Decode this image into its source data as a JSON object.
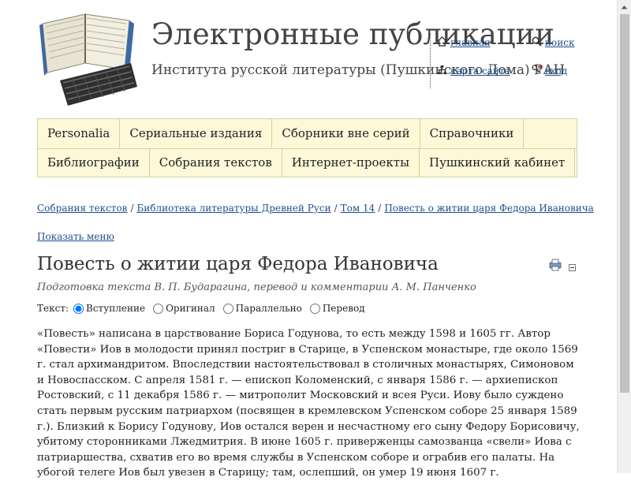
{
  "header": {
    "title": "Электронные публикации",
    "subtitle": "Института русской литературы (Пушкинского Дома) РАН"
  },
  "top_links": {
    "home": "главная",
    "search": "поиск",
    "sitemap": "карта сайта",
    "login": "вход"
  },
  "nav": {
    "row1": [
      "Personalia",
      "Сериальные издания",
      "Сборники вне серий",
      "Справочники"
    ],
    "row2": [
      "Библиографии",
      "Собрания текстов",
      "Интернет-проекты",
      "Пушкинский кабинет"
    ]
  },
  "breadcrumb": [
    "Собрания текстов",
    "Библиотека литературы Древней Руси",
    "Том 14",
    "Повесть о житии царя Федора Ивановича"
  ],
  "show_menu": "Показать меню",
  "page": {
    "title": "Повесть о житии царя Федора Ивановича",
    "subtitle": "Подготовка текста В. П. Бударагина, перевод и комментарии А. М. Панченко"
  },
  "text_options": {
    "label": "Текст:",
    "options": [
      "Вступление",
      "Оригинал",
      "Параллельно",
      "Перевод"
    ],
    "selected": "Вступление"
  },
  "body": "«Повесть» написана в царствование Бориса Годунова, то есть между 1598 и 1605 гг. Автор «Повести» Иов в молодости принял постриг в Старице, в Успенском монастыре, где около 1569 г. стал архимандритом. Впоследствии настоятельствовал в столичных монастырях, Симоновом и Новоспасском. С апреля 1581 г. — епископ Коломенский, с января 1586 г. — архиепископ Ростовский, с 11 декабря 1586 г. — митрополит Московский и всея Руси. Иову было суждено стать первым русским патриархом (посвящен в кремлевском Успенском соборе 25 января 1589 г.). Близкий к Борису Годунову, Иов остался верен и несчастному его сыну Федору Борисовичу, убитому сторонниками Лжедмитрия. В июне 1605 г. приверженцы самозванца «свели» Иова с патриаршества, схватив его во время службы в Успенском соборе и ограбив его палаты. На убогой телеге Иов был увезен в Старицу; там, ослепший, он умер 19 июня 1607 г."
}
